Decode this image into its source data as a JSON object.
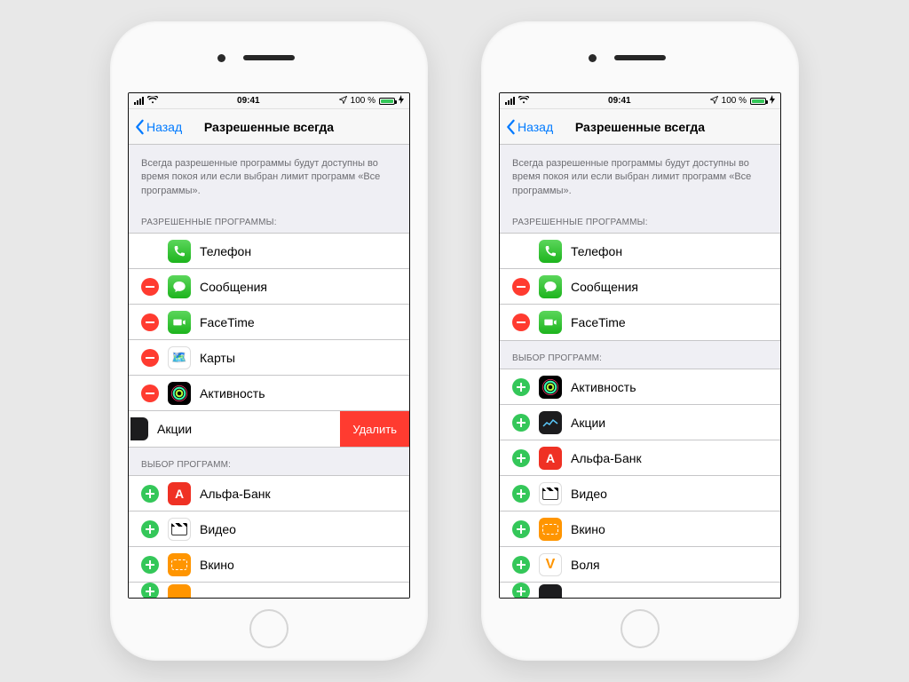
{
  "status": {
    "time": "09:41",
    "battery_label": "100 %"
  },
  "nav": {
    "back": "Назад",
    "title": "Разрешенные всегда"
  },
  "description": "Всегда разрешенные программы будут доступны во время покоя или если выбран лимит программ «Все программы».",
  "sections": {
    "allowed_header": "РАЗРЕШЕННЫЕ ПРОГРАММЫ:",
    "choose_header": "ВЫБОР ПРОГРАММ:"
  },
  "left": {
    "allowed": [
      {
        "name": "Телефон",
        "icon": "phone",
        "removable": false
      },
      {
        "name": "Сообщения",
        "icon": "messages",
        "removable": true
      },
      {
        "name": "FaceTime",
        "icon": "facetime",
        "removable": true
      },
      {
        "name": "Карты",
        "icon": "maps",
        "removable": true
      },
      {
        "name": "Активность",
        "icon": "activity",
        "removable": true
      }
    ],
    "swiped": {
      "name": "Акции",
      "icon": "stocks",
      "delete_label": "Удалить"
    },
    "choose": [
      {
        "name": "Альфа-Банк",
        "icon": "alfa"
      },
      {
        "name": "Видео",
        "icon": "video"
      },
      {
        "name": "Вкино",
        "icon": "vkino"
      }
    ]
  },
  "right": {
    "allowed": [
      {
        "name": "Телефон",
        "icon": "phone",
        "removable": false
      },
      {
        "name": "Сообщения",
        "icon": "messages",
        "removable": true
      },
      {
        "name": "FaceTime",
        "icon": "facetime",
        "removable": true
      }
    ],
    "choose": [
      {
        "name": "Активность",
        "icon": "activity"
      },
      {
        "name": "Акции",
        "icon": "stocks"
      },
      {
        "name": "Альфа-Банк",
        "icon": "alfa"
      },
      {
        "name": "Видео",
        "icon": "video"
      },
      {
        "name": "Вкино",
        "icon": "vkino"
      },
      {
        "name": "Воля",
        "icon": "volya"
      }
    ]
  }
}
